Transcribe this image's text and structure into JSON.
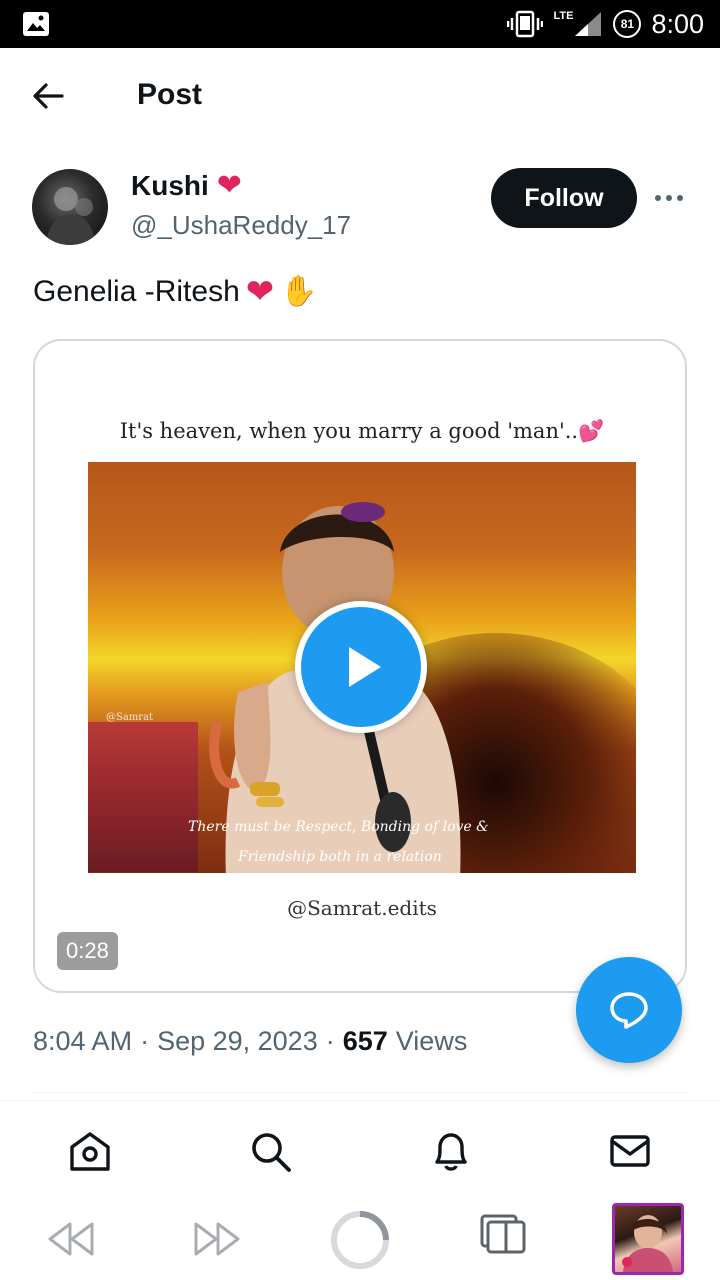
{
  "status_bar": {
    "network": "LTE",
    "battery": "81",
    "time": "8:00"
  },
  "header": {
    "title": "Post"
  },
  "post": {
    "author_name": "Kushi",
    "author_handle": "@_UshaReddy_17",
    "follow_label": "Follow",
    "text": "Genelia -Ritesh",
    "media": {
      "caption": "It's heaven, when you marry a good 'man'..",
      "watermark": "@Samrat",
      "subtitle_line1": "There must be Respect, Bonding of love &",
      "subtitle_line2": "Friendship both in a relation",
      "credit": "@Samrat.edits",
      "duration": "0:28"
    },
    "meta": {
      "time": "8:04 AM",
      "date": "Sep 29, 2023",
      "views_count": "657",
      "views_label": "Views"
    }
  },
  "colors": {
    "accent": "#1d9bf0",
    "text_primary": "#0f1419",
    "text_secondary": "#536471",
    "heart": "#e0245e"
  },
  "icons": {
    "back": "arrow-left-icon",
    "more": "more-horizontal-icon",
    "play": "play-icon",
    "compose": "reply-bubble-icon",
    "nav": [
      "home-icon",
      "search-icon",
      "bell-icon",
      "mail-icon"
    ],
    "system": [
      "rewind-icon",
      "fast-forward-icon",
      "loading-ring-icon",
      "tabs-icon"
    ]
  }
}
